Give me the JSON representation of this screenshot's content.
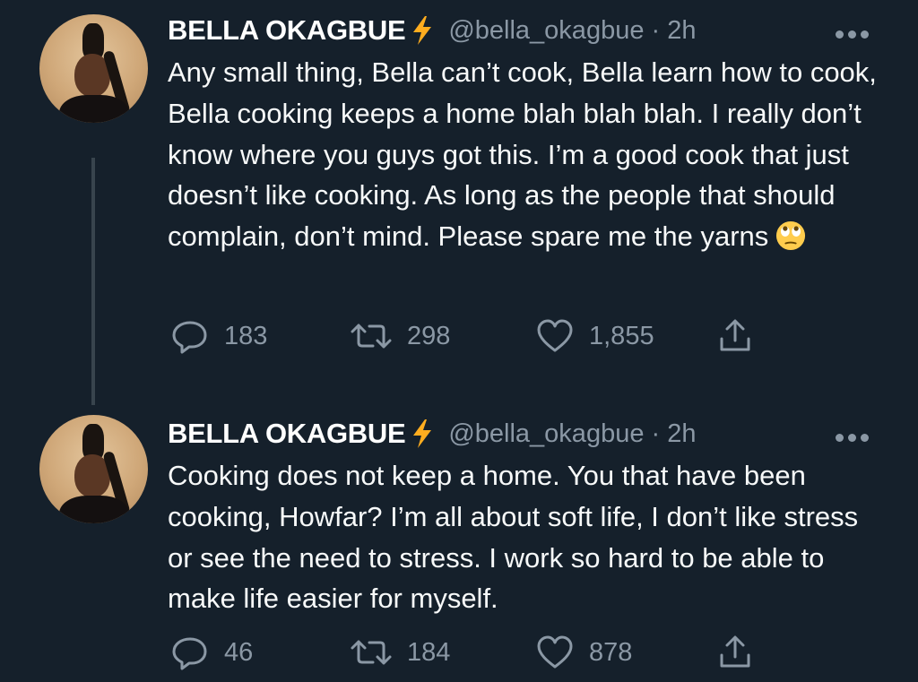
{
  "tweets": [
    {
      "name": "BELLA OKAGBUE",
      "handle": "@bella_okagbue · 2h",
      "text": "Any small thing, Bella can’t cook, Bella learn how to cook, Bella cooking keeps a home blah blah blah. I really don’t know where you guys got this. I’m a good cook that just doesn’t like cooking. As long as the people that should complain, don’t mind. Please spare me the yarns",
      "emoji": "eye-roll-emoji",
      "replies": "183",
      "retweets": "298",
      "likes": "1,855"
    },
    {
      "name": "BELLA OKAGBUE",
      "handle": "@bella_okagbue · 2h",
      "text": "Cooking does not keep a home. You that have been cooking, Howfar? I’m all about soft life, I don’t like stress or see the need to stress. I work so hard to be able to make life easier for myself.",
      "replies": "46",
      "retweets": "184",
      "likes": "878"
    }
  ],
  "colors": {
    "background": "#15202b",
    "text": "#f7f9f9",
    "secondary": "#8b98a5",
    "verified_bolt": "#ffad1f",
    "thread_line": "#38444d"
  },
  "icons": [
    "lightning-bolt-icon",
    "more-options-icon",
    "reply-icon",
    "retweet-icon",
    "like-icon",
    "share-icon"
  ]
}
